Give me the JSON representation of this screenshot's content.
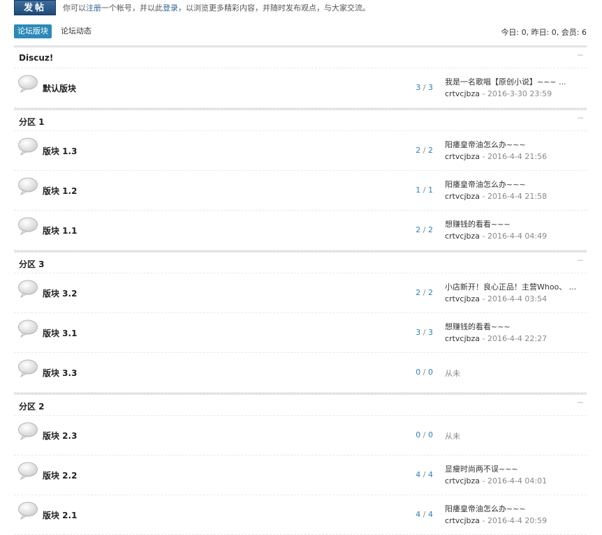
{
  "top": {
    "post_button": "发帖",
    "notice_pre": "你可以",
    "notice_register": "注册",
    "notice_mid": "一个帐号，并以此",
    "notice_login": "登录",
    "notice_post": "，以浏览更多精彩内容，并随时发布观点，与大家交流。"
  },
  "tabs": {
    "active": "论坛版块",
    "other": "论坛动态"
  },
  "stats": {
    "text": "今日: 0, 昨日: 0, 会员: 6"
  },
  "categories": [
    {
      "name": "Discuz!",
      "forums": [
        {
          "name": "默认版块",
          "threads": "3",
          "posts": "3",
          "last_title": "我是一名歌唱【原创小说】~~~ ...",
          "last_user": "crtvcjbza",
          "last_time": "2016-3-30 23:59"
        }
      ]
    },
    {
      "name": "分区 1",
      "forums": [
        {
          "name": "版块 1.3",
          "threads": "2",
          "posts": "2",
          "last_title": "阳痿皇帝油怎么办~~~",
          "last_user": "crtvcjbza",
          "last_time": "2016-4-4 21:56"
        },
        {
          "name": "版块 1.2",
          "threads": "1",
          "posts": "1",
          "last_title": "阳痿皇帝油怎么办~~~",
          "last_user": "crtvcjbza",
          "last_time": "2016-4-4 21:58"
        },
        {
          "name": "版块 1.1",
          "threads": "2",
          "posts": "2",
          "last_title": "想赚钱的看看~~~",
          "last_user": "crtvcjbza",
          "last_time": "2016-4-4 04:49"
        }
      ]
    },
    {
      "name": "分区 3",
      "forums": [
        {
          "name": "版块 3.2",
          "threads": "2",
          "posts": "2",
          "last_title": "小店新开！良心正品！主营Whoo、 ...",
          "last_user": "crtvcjbza",
          "last_time": "2016-4-4 03:54"
        },
        {
          "name": "版块 3.1",
          "threads": "3",
          "posts": "3",
          "last_title": "想赚钱的看看~~~",
          "last_user": "crtvcjbza",
          "last_time": "2016-4-4 22:27"
        },
        {
          "name": "版块 3.3",
          "threads": "0",
          "posts": "0",
          "never": "从未"
        }
      ]
    },
    {
      "name": "分区 2",
      "forums": [
        {
          "name": "版块 2.3",
          "threads": "0",
          "posts": "0",
          "never": "从未"
        },
        {
          "name": "版块 2.2",
          "threads": "4",
          "posts": "4",
          "last_title": "显瘦时尚两不误~~~",
          "last_user": "crtvcjbza",
          "last_time": "2016-4-4 04:01"
        },
        {
          "name": "版块 2.1",
          "threads": "4",
          "posts": "4",
          "last_title": "阳痿皇帝油怎么办~~~",
          "last_user": "crtvcjbza",
          "last_time": "2016-4-4 20:59"
        }
      ]
    }
  ],
  "ui": {
    "collapse_glyph": "−",
    "count_sep": " / ",
    "meta_sep": " - "
  },
  "colors": {
    "accent": "#2b8ab8",
    "link": "#336699",
    "button": "#1e4a78"
  }
}
